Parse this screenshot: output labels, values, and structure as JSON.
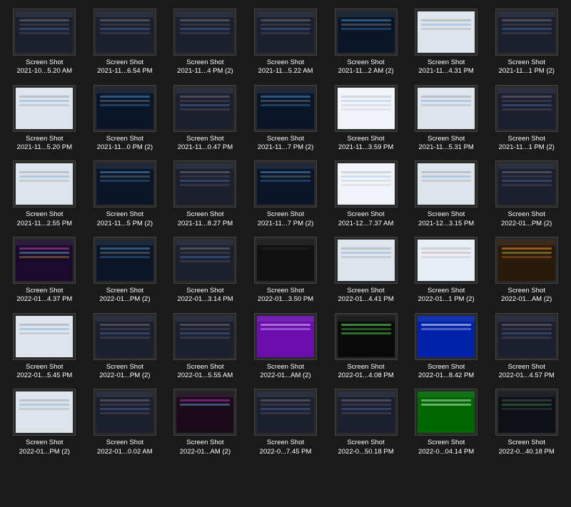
{
  "grid": {
    "items": [
      {
        "id": 1,
        "label": "Screen Shot",
        "date": "2021-10...5.20 AM",
        "thumb": "dark",
        "row": 0
      },
      {
        "id": 2,
        "label": "Screen Shot",
        "date": "2021-11...6.54 PM",
        "thumb": "dark",
        "row": 0
      },
      {
        "id": 3,
        "label": "Screen Shot",
        "date": "2021-11...4 PM (2)",
        "thumb": "dark",
        "row": 0
      },
      {
        "id": 4,
        "label": "Screen Shot",
        "date": "2021-11...5.22 AM",
        "thumb": "dark",
        "row": 0
      },
      {
        "id": 5,
        "label": "Screen Shot",
        "date": "2021-11...2 AM (2)",
        "thumb": "blue",
        "row": 0
      },
      {
        "id": 6,
        "label": "Screen Shot",
        "date": "2021-11...4.31 PM",
        "thumb": "light",
        "row": 0
      },
      {
        "id": 7,
        "label": "Screen Shot",
        "date": "2021-11...1 PM (2)",
        "thumb": "dark",
        "row": 0
      },
      {
        "id": 8,
        "label": "Screen Shot",
        "date": "2021-11...5.20 PM",
        "thumb": "light",
        "row": 1
      },
      {
        "id": 9,
        "label": "Screen Shot",
        "date": "2021-11...0 PM (2)",
        "thumb": "blue",
        "row": 1
      },
      {
        "id": 10,
        "label": "Screen Shot",
        "date": "2021-11...0.47 PM",
        "thumb": "dark",
        "row": 1
      },
      {
        "id": 11,
        "label": "Screen Shot",
        "date": "2021-11...7 PM (2)",
        "thumb": "blue",
        "row": 1
      },
      {
        "id": 12,
        "label": "Screen Shot",
        "date": "2021-11...3.59 PM",
        "thumb": "white",
        "row": 1
      },
      {
        "id": 13,
        "label": "Screen Shot",
        "date": "2021-11...5.31 PM",
        "thumb": "light",
        "row": 1
      },
      {
        "id": 14,
        "label": "Screen Shot",
        "date": "2021-11...1 PM (2)",
        "thumb": "dark",
        "row": 1
      },
      {
        "id": 15,
        "label": "Screen Shot",
        "date": "2021-11...2.55 PM",
        "thumb": "light",
        "row": 2
      },
      {
        "id": 16,
        "label": "Screen Shot",
        "date": "2021-11...5 PM (2)",
        "thumb": "blue",
        "row": 2
      },
      {
        "id": 17,
        "label": "Screen Shot",
        "date": "2021-11...8.27 PM",
        "thumb": "dark",
        "row": 2
      },
      {
        "id": 18,
        "label": "Screen Shot",
        "date": "2021-11...7 PM (2)",
        "thumb": "blue",
        "row": 2
      },
      {
        "id": 19,
        "label": "Screen Shot",
        "date": "2021-12...7.37 AM",
        "thumb": "white",
        "row": 2
      },
      {
        "id": 20,
        "label": "Screen Shot",
        "date": "2021-12...3.15 PM",
        "thumb": "light",
        "row": 2
      },
      {
        "id": 21,
        "label": "Screen Shot",
        "date": "2022-01...PM (2)",
        "thumb": "dark",
        "row": 2
      },
      {
        "id": 22,
        "label": "Screen Shot",
        "date": "2022-01...4.37 PM",
        "thumb": "colorful",
        "row": 3
      },
      {
        "id": 23,
        "label": "Screen Shot",
        "date": "2022-01...PM (2)",
        "thumb": "blue",
        "row": 3
      },
      {
        "id": 24,
        "label": "Screen Shot",
        "date": "2022-01...3.14 PM",
        "thumb": "dark",
        "row": 3
      },
      {
        "id": 25,
        "label": "Screen Shot",
        "date": "2022-01...3.50 PM",
        "thumb": "black",
        "row": 3
      },
      {
        "id": 26,
        "label": "Screen Shot",
        "date": "2022-01...4.41 PM",
        "thumb": "light",
        "row": 3
      },
      {
        "id": 27,
        "label": "Screen Shot",
        "date": "2022-01...1 PM (2)",
        "thumb": "light2",
        "row": 3
      },
      {
        "id": 28,
        "label": "Screen Shot",
        "date": "2022-01...AM (2)",
        "thumb": "colorful2",
        "row": 3
      },
      {
        "id": 29,
        "label": "Screen Shot",
        "date": "2022-01...5.45 PM",
        "thumb": "light",
        "row": 4
      },
      {
        "id": 30,
        "label": "Screen Shot",
        "date": "2022-01...PM (2)",
        "thumb": "dark",
        "row": 4
      },
      {
        "id": 31,
        "label": "Screen Shot",
        "date": "2022-01...5.55 AM",
        "thumb": "dark",
        "row": 4
      },
      {
        "id": 32,
        "label": "Screen Shot",
        "date": "2022-01...AM (2)",
        "thumb": "purple",
        "row": 4
      },
      {
        "id": 33,
        "label": "Screen Shot",
        "date": "2022-01...4.08 PM",
        "thumb": "terminal",
        "row": 4
      },
      {
        "id": 34,
        "label": "Screen Shot",
        "date": "2022-01...8.42 PM",
        "thumb": "blue2",
        "row": 4
      },
      {
        "id": 35,
        "label": "Screen Shot",
        "date": "2022-01...4.57 PM",
        "thumb": "dark",
        "row": 4
      },
      {
        "id": 36,
        "label": "Screen Shot",
        "date": "2022-01...PM (2)",
        "thumb": "light",
        "row": 5
      },
      {
        "id": 37,
        "label": "Screen Shot",
        "date": "2022-01...0.02 AM",
        "thumb": "dark",
        "row": 5
      },
      {
        "id": 38,
        "label": "Screen Shot",
        "date": "2022-01...AM (2)",
        "thumb": "colorful3",
        "row": 5
      },
      {
        "id": 39,
        "label": "Screen Shot",
        "date": "2022-0...7.45 PM",
        "thumb": "dark",
        "row": 5
      },
      {
        "id": 40,
        "label": "Screen Shot",
        "date": "2022-0...50.18 PM",
        "thumb": "dark",
        "row": 5
      },
      {
        "id": 41,
        "label": "Screen Shot",
        "date": "2022-0...04.14 PM",
        "thumb": "green",
        "row": 5
      },
      {
        "id": 42,
        "label": "Screen Shot",
        "date": "2022-0...40.18 PM",
        "thumb": "dark2",
        "row": 5
      }
    ]
  }
}
